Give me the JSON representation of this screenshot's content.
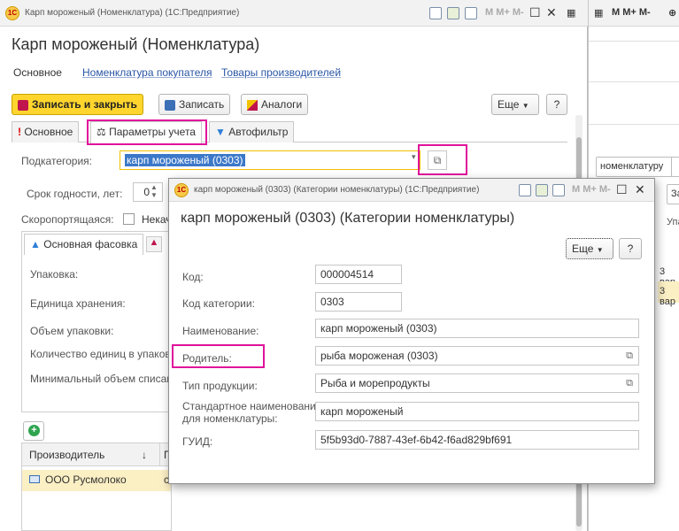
{
  "main_window": {
    "title": "Карп мороженый (Номенклатура)  (1С:Предприятие)",
    "form_title": "Карп мороженый (Номенклатура)",
    "nav": {
      "main": "Основное",
      "buyer_nomenclature": "Номенклатура покупателя",
      "producer_goods": "Товары производителей"
    },
    "toolbar": {
      "save_close": "Записать и закрыть",
      "save": "Записать",
      "analogs": "Аналоги",
      "more": "Еще",
      "help": "?"
    },
    "tabs": {
      "main": "Основное",
      "accounting_params": "Параметры учета",
      "autofilter": "Автофильтр"
    },
    "subcategory_label": "Подкатегория:",
    "subcategory_value": "карп мороженый (0303)",
    "shelf_life_label": "Срок годности, лет:",
    "shelf_life_value": "0",
    "perishable_label": "Скоропортящаяся:",
    "perishable_extra": "Некач",
    "pack_tab": "Основная фасовка",
    "pack_fields": {
      "pack": "Упаковка:",
      "storage_unit": "Единица хранения:",
      "pack_volume": "Объем упаковки:",
      "units_count": "Количество единиц в упаковк",
      "min_writeoff": "Минимальный объем списани"
    },
    "grid": {
      "col_producer": "Производитель",
      "col_sort": "↓",
      "col_next": "П",
      "row_producer": "ООО Русмолоко",
      "row_next": "с"
    }
  },
  "background_window": {
    "toolbar_text": "M  M+  M-",
    "btn_nomenclature": "номенклатуру",
    "btn_partial": "За",
    "header_partial": "Упако",
    "row1": "3 вар",
    "row2": "3 вар"
  },
  "popup": {
    "title": "карп мороженый (0303) (Категории номенклатуры)  (1С:Предприятие)",
    "heading": "карп мороженый (0303) (Категории номенклатуры)",
    "more": "Еще",
    "help": "?",
    "toolbar_text": "M  M+  M-",
    "fields": {
      "code_label": "Код:",
      "code_value": "000004514",
      "category_code_label": "Код категории:",
      "category_code_value": "0303",
      "name_label": "Наименование:",
      "name_value": "карп мороженый (0303)",
      "parent_label": "Родитель:",
      "parent_value": "рыба мороженая (0303)",
      "product_type_label": "Тип продукции:",
      "product_type_value": "Рыба и морепродукты",
      "std_name_label_1": "Стандартное наименование",
      "std_name_label_2": "для номенклатуры:",
      "std_name_value": "карп мороженый",
      "guid_label": "ГУИД:",
      "guid_value": "5f5b93d0-7887-43ef-6b42-f6ad829bf691"
    }
  },
  "colors": {
    "accent_highlight": "#e0129b",
    "primary_button": "#ffd52e",
    "link": "#2a56a6",
    "selected_row": "#fbefc4"
  }
}
